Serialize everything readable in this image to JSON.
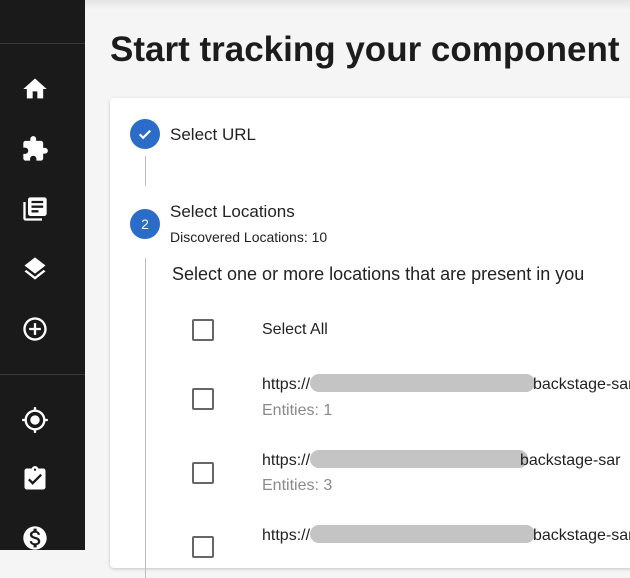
{
  "page": {
    "title": "Start tracking your component"
  },
  "sidebar": {
    "items": [
      {
        "icon": "home-icon",
        "label": "Home"
      },
      {
        "icon": "puzzle-icon",
        "label": "Plugins"
      },
      {
        "icon": "library-books-icon",
        "label": "Docs"
      },
      {
        "icon": "layers-icon",
        "label": "Layers"
      },
      {
        "icon": "add-circle-icon",
        "label": "Create"
      },
      {
        "icon": "target-icon",
        "label": "Tracking"
      },
      {
        "icon": "clipboard-check-icon",
        "label": "Checks"
      },
      {
        "icon": "dollar-icon",
        "label": "Cost"
      }
    ]
  },
  "stepper": {
    "step1": {
      "label": "Select URL",
      "icon": "check-icon"
    },
    "step2": {
      "number": "2",
      "label": "Select Locations",
      "subtitle": "Discovered Locations: 10"
    },
    "instructions": "Select one or more locations that are present in you",
    "select_all_label": "Select All",
    "locations": [
      {
        "url_prefix": "https://",
        "url_suffix": "backstage-sar",
        "entities": "Entities: 1"
      },
      {
        "url_prefix": "https://",
        "url_suffix": "backstage-sar",
        "entities": "Entities: 3"
      },
      {
        "url_prefix": "https://",
        "url_suffix": "backstage-sar",
        "entities": ""
      }
    ]
  },
  "colors": {
    "sidebar_bg": "#1a1a1a",
    "accent": "#2a6cc7",
    "redaction": "#c4c4c4"
  }
}
